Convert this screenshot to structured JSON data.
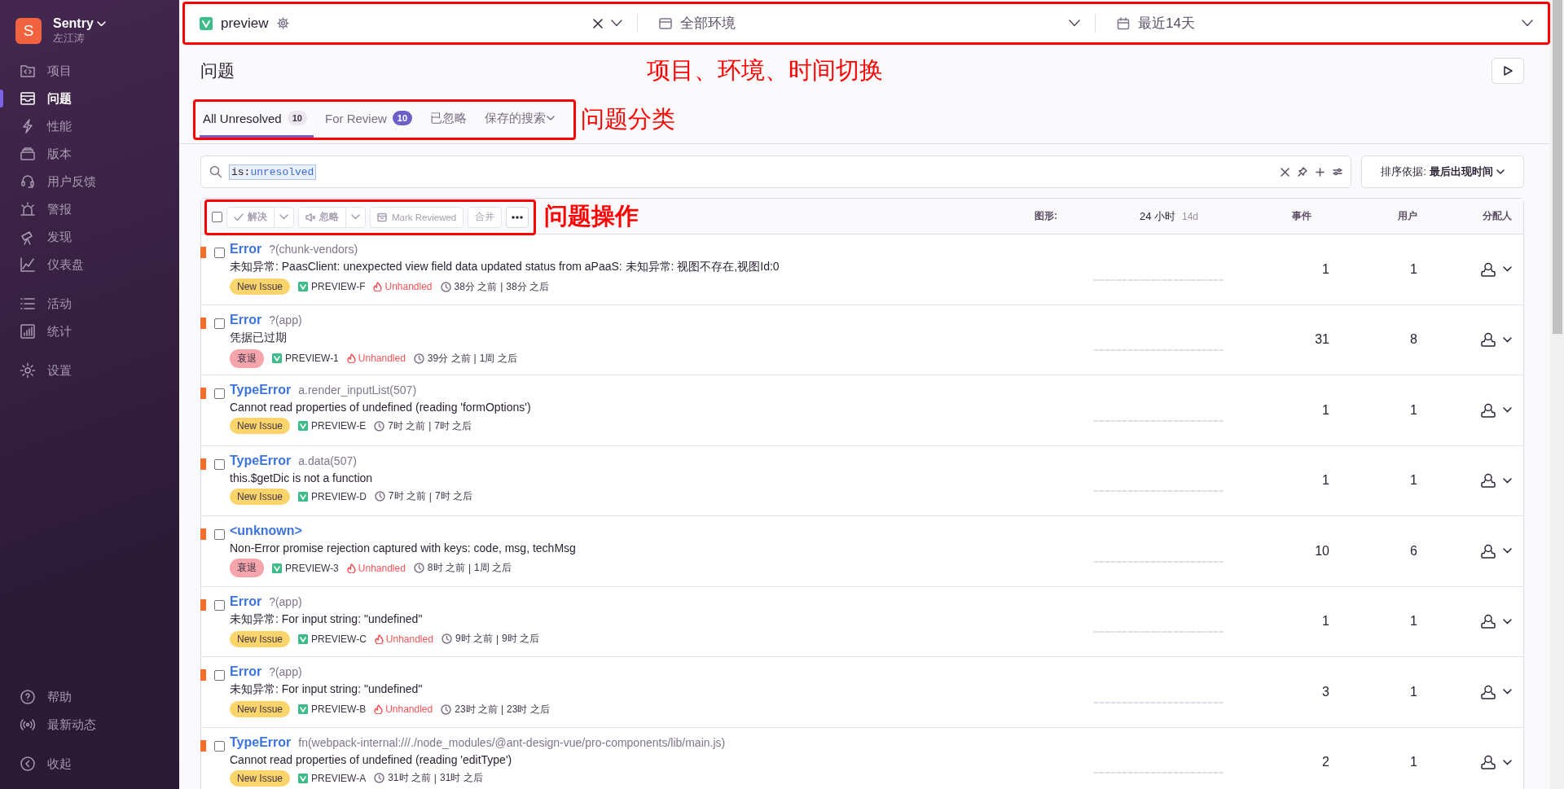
{
  "sidebar": {
    "org": {
      "initial": "S",
      "name": "Sentry",
      "user": "左江涛"
    },
    "items": [
      {
        "label": "项目",
        "selected": false
      },
      {
        "label": "问题",
        "selected": true
      },
      {
        "label": "性能",
        "selected": false
      },
      {
        "label": "版本",
        "selected": false
      },
      {
        "label": "用户反馈",
        "selected": false
      },
      {
        "label": "警报",
        "selected": false
      },
      {
        "label": "发现",
        "selected": false
      },
      {
        "label": "仪表盘",
        "selected": false
      },
      {
        "label": "活动",
        "selected": false
      },
      {
        "label": "统计",
        "selected": false
      },
      {
        "label": "设置",
        "selected": false
      }
    ],
    "footer_items": [
      {
        "label": "帮助"
      },
      {
        "label": "最新动态"
      },
      {
        "label": "收起"
      }
    ]
  },
  "top_bar": {
    "project": "preview",
    "environment": "全部环境",
    "date_range": "最近14天"
  },
  "page": {
    "title": "问题"
  },
  "annotations": {
    "scope_switch": "项目、环境、时间切换",
    "tabs": "问题分类",
    "actions": "问题操作"
  },
  "tabs": [
    {
      "label": "All Unresolved",
      "count": "10",
      "count_accent": false,
      "selected": true
    },
    {
      "label": "For Review",
      "count": "10",
      "count_accent": true,
      "selected": false
    },
    {
      "label": "已忽略",
      "selected": false
    },
    {
      "label": "保存的搜索",
      "dropdown": true,
      "selected": false
    }
  ],
  "search": {
    "query": "**is:**unresolved"
  },
  "sort": {
    "label": "排序依据:",
    "value": "最后出现时间"
  },
  "toolbar": {
    "checked": false,
    "actions": [
      {
        "label": "解决",
        "kind": "split"
      },
      {
        "label": "忽略",
        "kind": "split"
      },
      {
        "label": "Mark Reviewed",
        "kind": "plain"
      },
      {
        "label": "合并",
        "kind": "plain"
      }
    ]
  },
  "columns": {
    "graph": "图形:",
    "periods": [
      {
        "label": "24 小时",
        "selected": true
      },
      {
        "label": "14d",
        "selected": false
      }
    ],
    "events": "事件",
    "users": "用户",
    "assignee": "分配人"
  },
  "issues": [
    {
      "type": "Error",
      "culprit": "?(chunk-vendors)",
      "message": "未知异常: PaasClient: unexpected view field data updated status from aPaaS: 未知异常: 视图不存在,视图Id:0",
      "badge": {
        "kind": "new",
        "label": "New Issue"
      },
      "short_id": "PREVIEW-F",
      "unhandled": "Unhandled",
      "first_seen": "38分 之前",
      "separator": "|",
      "last_seen": "38分 之后",
      "events": "1",
      "users": "1",
      "checked": false
    },
    {
      "type": "Error",
      "culprit": "?(app)",
      "message": "凭据已过期",
      "badge": {
        "kind": "regressed",
        "label": "衰退"
      },
      "short_id": "PREVIEW-1",
      "unhandled": "Unhandled",
      "first_seen": "39分 之前",
      "separator": "|",
      "last_seen": "1周 之后",
      "events": "31",
      "users": "8",
      "checked": false
    },
    {
      "type": "TypeError",
      "culprit": "a.render_inputList(507)",
      "message": "Cannot read properties of undefined (reading 'formOptions')",
      "badge": {
        "kind": "new",
        "label": "New Issue"
      },
      "short_id": "PREVIEW-E",
      "first_seen": "7时 之前",
      "separator": "|",
      "last_seen": "7时 之后",
      "events": "1",
      "users": "1",
      "checked": false
    },
    {
      "type": "TypeError",
      "culprit": "a.data(507)",
      "message": "this.$getDic is not a function",
      "badge": {
        "kind": "new",
        "label": "New Issue"
      },
      "short_id": "PREVIEW-D",
      "first_seen": "7时 之前",
      "separator": "|",
      "last_seen": "7时 之后",
      "events": "1",
      "users": "1",
      "checked": false
    },
    {
      "type": "<unknown>",
      "message": "Non-Error promise rejection captured with keys: code, msg, techMsg",
      "badge": {
        "kind": "regressed",
        "label": "衰退"
      },
      "short_id": "PREVIEW-3",
      "unhandled": "Unhandled",
      "first_seen": "8时 之前",
      "separator": "|",
      "last_seen": "1周 之后",
      "events": "10",
      "users": "6",
      "checked": false
    },
    {
      "type": "Error",
      "culprit": "?(app)",
      "message": "未知异常: For input string: \"undefined\"",
      "badge": {
        "kind": "new",
        "label": "New Issue"
      },
      "short_id": "PREVIEW-C",
      "unhandled": "Unhandled",
      "first_seen": "9时 之前",
      "separator": "|",
      "last_seen": "9时 之后",
      "events": "1",
      "users": "1",
      "checked": false
    },
    {
      "type": "Error",
      "culprit": "?(app)",
      "message": "未知异常: For input string: \"undefined\"",
      "badge": {
        "kind": "new",
        "label": "New Issue"
      },
      "short_id": "PREVIEW-B",
      "unhandled": "Unhandled",
      "first_seen": "23时 之前",
      "separator": "|",
      "last_seen": "23时 之后",
      "events": "3",
      "users": "1",
      "checked": false
    },
    {
      "type": "TypeError",
      "culprit": "fn(webpack-internal:///./node_modules/@ant-design-vue/pro-components/lib/main.js)",
      "message": "Cannot read properties of undefined (reading 'editType')",
      "badge": {
        "kind": "new",
        "label": "New Issue"
      },
      "short_id": "PREVIEW-A",
      "first_seen": "31时 之前",
      "separator": "|",
      "last_seen": "31时 之后",
      "events": "2",
      "users": "1",
      "checked": false
    }
  ]
}
